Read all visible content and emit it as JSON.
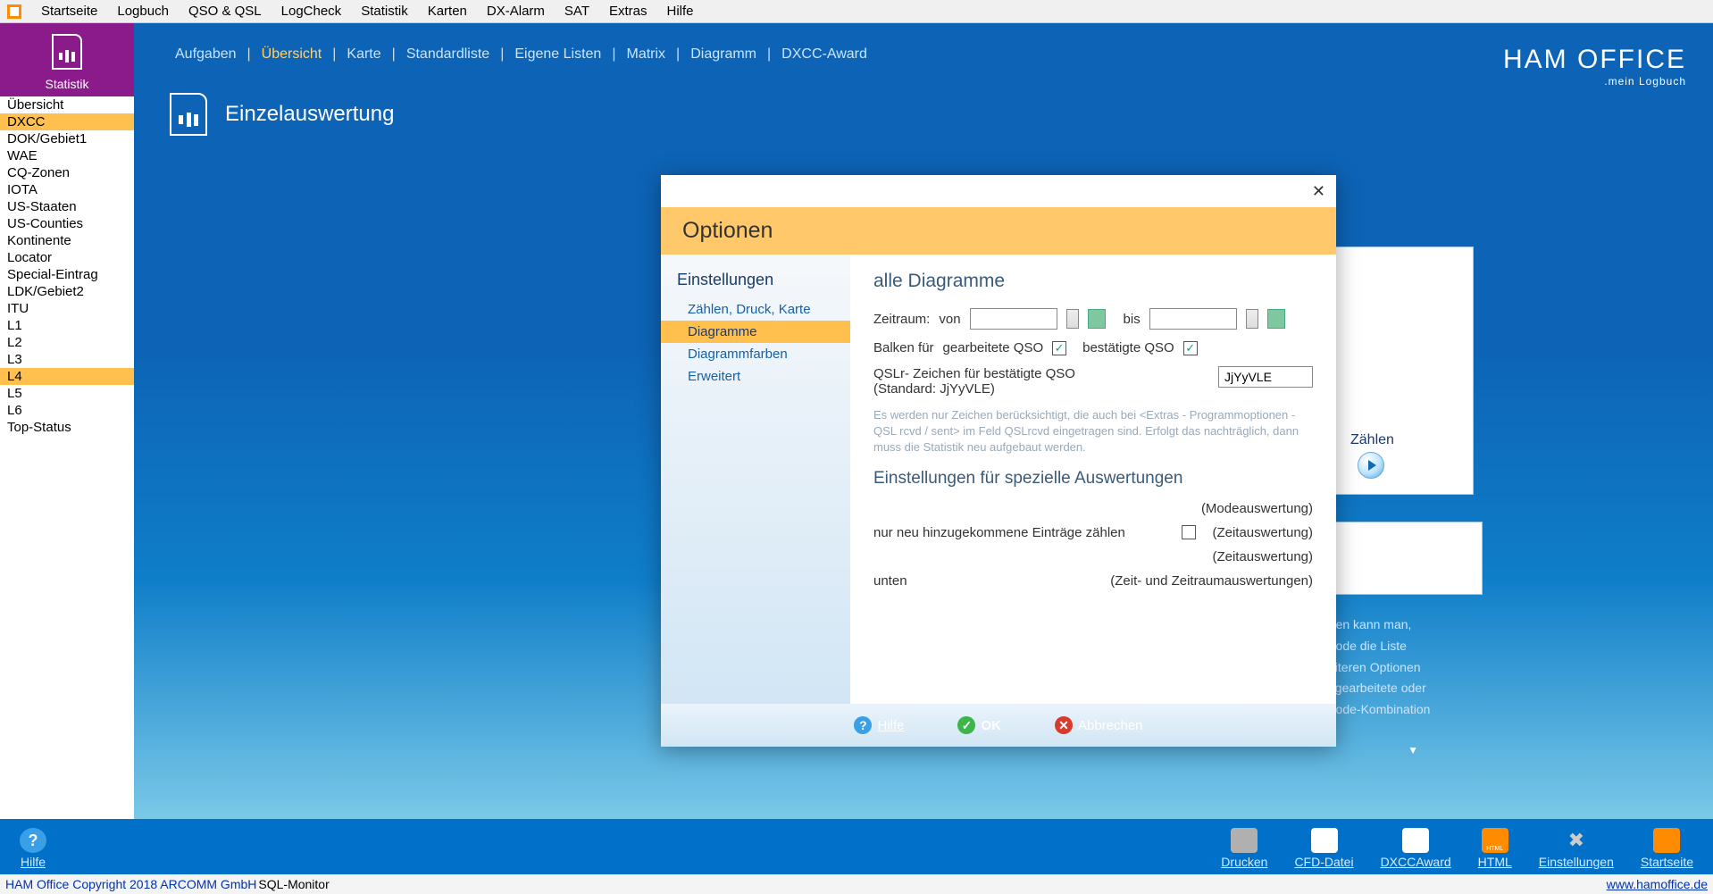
{
  "menubar": [
    "Startseite",
    "Logbuch",
    "QSO & QSL",
    "LogCheck",
    "Statistik",
    "Karten",
    "DX-Alarm",
    "SAT",
    "Extras",
    "Hilfe"
  ],
  "sidebar": {
    "header": "Statistik",
    "items": [
      "Übersicht",
      "DXCC",
      "DOK/Gebiet1",
      "WAE",
      "CQ-Zonen",
      "IOTA",
      "US-Staaten",
      "US-Counties",
      "Kontinente",
      "Locator",
      "Special-Eintrag",
      "LDK/Gebiet2",
      "ITU",
      "L1",
      "L2",
      "L3",
      "L4",
      "L5",
      "L6",
      "Top-Status"
    ],
    "selected": [
      "DXCC",
      "L4"
    ]
  },
  "subnav": {
    "items": [
      "Aufgaben",
      "Übersicht",
      "Karte",
      "Standardliste",
      "Eigene Listen",
      "Matrix",
      "Diagramm",
      "DXCC-Award"
    ],
    "active": "Übersicht"
  },
  "brand": {
    "title": "HAM OFFICE",
    "sub": ".mein Logbuch"
  },
  "page_title": "Einzelauswertung",
  "action": {
    "label": "Zählen"
  },
  "hint": "ngen kann man,\n/Mode die Liste\nveiteren Optionen\nst gearbeitete oder\n/Mode-Kombination",
  "modal": {
    "title": "Optionen",
    "side_head": "Einstellungen",
    "side_items": [
      "Zählen, Druck, Karte",
      "Diagramme",
      "Diagrammfarben",
      "Erweitert"
    ],
    "side_selected": "Diagramme",
    "section1": "alle Diagramme",
    "zeitraum_lbl": "Zeitraum:",
    "von": "von",
    "bis": "bis",
    "balken_lbl": "Balken für",
    "gearbeitete": "gearbeitete QSO",
    "bestaetigte": "bestätigte QSO",
    "qslr_line1": "QSLr- Zeichen für bestätigte QSO",
    "qslr_line2": "(Standard: JjYyVLE)",
    "qslr_value": "JjYyVLE",
    "fineprint": "Es werden nur Zeichen berücksichtigt, die auch bei <Extras - Programmoptionen - QSL rcvd / sent> im Feld QSLrcvd eingetragen sind. Erfolgt das nachträglich, dann muss die Statistik neu aufgebaut werden.",
    "section2": "Einstellungen für spezielle Auswertungen",
    "row_mode": "(Modeauswertung)",
    "row_neu": "nur neu hinzugekommene Einträge zählen",
    "row_zeit": "(Zeitauswertung)",
    "row_zeit2": "(Zeitauswertung)",
    "row_unten": "unten",
    "row_zz": "(Zeit- und Zeitraumauswertungen)",
    "footer": {
      "hilfe": "Hilfe",
      "ok": "OK",
      "abbrechen": "Abbrechen"
    }
  },
  "bottombar": {
    "hilfe": "Hilfe",
    "items": [
      "Drucken",
      "CFD-Datei",
      "DXCCAward",
      "HTML",
      "Einstellungen",
      "Startseite"
    ]
  },
  "status": {
    "copyright": "HAM Office Copyright 2018 ARCOMM GmbH",
    "sql": "SQL-Monitor",
    "url": "www.hamoffice.de"
  }
}
